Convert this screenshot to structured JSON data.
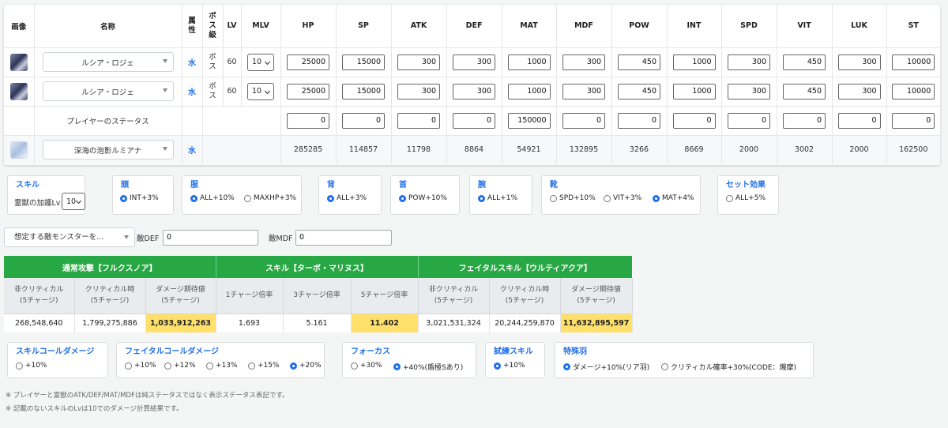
{
  "table": {
    "headers": {
      "image": "画像",
      "name": "名称",
      "attr": "属性",
      "boss": "ボス級",
      "lv": "LV",
      "mlv": "MLV",
      "hp": "HP",
      "sp": "SP",
      "atk": "ATK",
      "def": "DEF",
      "mat": "MAT",
      "mdf": "MDF",
      "pow": "POW",
      "int": "INT",
      "spd": "SPD",
      "vit": "VIT",
      "luk": "LUK",
      "st": "ST"
    },
    "rows": [
      {
        "name": "ルシア・ロジェ",
        "attr": "水",
        "boss": "ボス",
        "lv": "60",
        "mlv": "10",
        "hp": "25000",
        "sp": "15000",
        "atk": "300",
        "def": "300",
        "mat": "1000",
        "mdf": "300",
        "pow": "450",
        "int": "1000",
        "spd": "300",
        "vit": "450",
        "luk": "300",
        "st": "10000"
      },
      {
        "name": "ルシア・ロジェ",
        "attr": "水",
        "boss": "ボス",
        "lv": "60",
        "mlv": "10",
        "hp": "25000",
        "sp": "15000",
        "atk": "300",
        "def": "300",
        "mat": "1000",
        "mdf": "300",
        "pow": "450",
        "int": "1000",
        "spd": "300",
        "vit": "450",
        "luk": "300",
        "st": "10000"
      }
    ],
    "player": {
      "label": "プレイヤーのステータス",
      "hp": "0",
      "sp": "0",
      "atk": "0",
      "def": "0",
      "mat": "150000",
      "mdf": "0",
      "pow": "0",
      "int": "0",
      "spd": "0",
      "vit": "0",
      "luk": "0",
      "st": "0"
    },
    "result": {
      "name": "深海の泡影ルミアナ",
      "attr": "水",
      "hp": "285285",
      "sp": "114857",
      "atk": "11798",
      "def": "8864",
      "mat": "54921",
      "mdf": "132895",
      "pow": "3266",
      "int": "8669",
      "spd": "2000",
      "vit": "3002",
      "luk": "2000",
      "st": "162500"
    }
  },
  "equip": {
    "skill": {
      "title": "スキル",
      "label": "霊獣の加護Lv",
      "value": "10"
    },
    "head": {
      "title": "頭",
      "opt1": "INT+3%"
    },
    "body": {
      "title": "服",
      "opt1": "ALL+10%",
      "opt2": "MAXHP+3%"
    },
    "back": {
      "title": "背",
      "opt1": "ALL+3%"
    },
    "neck": {
      "title": "首",
      "opt1": "POW+10%"
    },
    "arm": {
      "title": "腕",
      "opt1": "ALL+1%"
    },
    "feet": {
      "title": "靴",
      "opt1": "SPD+10%",
      "opt2": "VIT+3%",
      "opt3": "MAT+4%"
    },
    "set": {
      "title": "セット効果",
      "opt1": "ALL+5%"
    }
  },
  "enemy": {
    "placeholder": "想定する敵モンスターを...",
    "def_label": "敵DEF",
    "def_value": "0",
    "mdf_label": "敵MDF",
    "mdf_value": "0"
  },
  "damage": {
    "groups": [
      "通常攻撃【フルクスノア】",
      "スキル【ターボ・マリヌス】",
      "フェイタルスキル【ウルティアクア】"
    ],
    "sub": [
      [
        "非クリティカル",
        "(5チャージ)"
      ],
      [
        "クリティカル時",
        "(5チャージ)"
      ],
      [
        "ダメージ期待値",
        "(5チャージ)"
      ],
      [
        "1チャージ倍率",
        ""
      ],
      [
        "3チャージ倍率",
        ""
      ],
      [
        "5チャージ倍率",
        ""
      ],
      [
        "非クリティカル",
        "(5チャージ)"
      ],
      [
        "クリティカル時",
        "(5チャージ)"
      ],
      [
        "ダメージ期待値",
        "(5チャージ)"
      ]
    ],
    "values": [
      "268,548,640",
      "1,799,275,886",
      "1,033,912,263",
      "1.693",
      "5.161",
      "11.402",
      "3,021,531,324",
      "20,244,259,870",
      "11,632,895,597"
    ]
  },
  "bottom": {
    "skill_call": {
      "title": "スキルコールダメージ",
      "opt1": "+10%"
    },
    "fatal_call": {
      "title": "フェイタルコールダメージ",
      "opt1": "+10%",
      "opt2": "+12%",
      "opt3": "+13%",
      "opt4": "+15%",
      "opt5": "+20%"
    },
    "focus": {
      "title": "フォーカス",
      "opt1": "+30%",
      "opt2": "+40%(盾極Sあり)"
    },
    "trial": {
      "title": "試練スキル",
      "opt1": "+10%"
    },
    "feather": {
      "title": "特殊羽",
      "opt1": "ダメージ+10%(リア羽)",
      "opt2": "クリティカル確率+30%(CODE：熾摩)"
    }
  },
  "notes": [
    "※ プレイヤーと霊獣のATK/DEF/MAT/MDFは純ステータスではなく表示ステータス表記です。",
    "※ 記載のないスキルのLvは10でのダメージ計算結果です。"
  ],
  "colors": {
    "accent": "#1f6feb",
    "header_green": "#27a844",
    "highlight": "#ffe06a"
  }
}
